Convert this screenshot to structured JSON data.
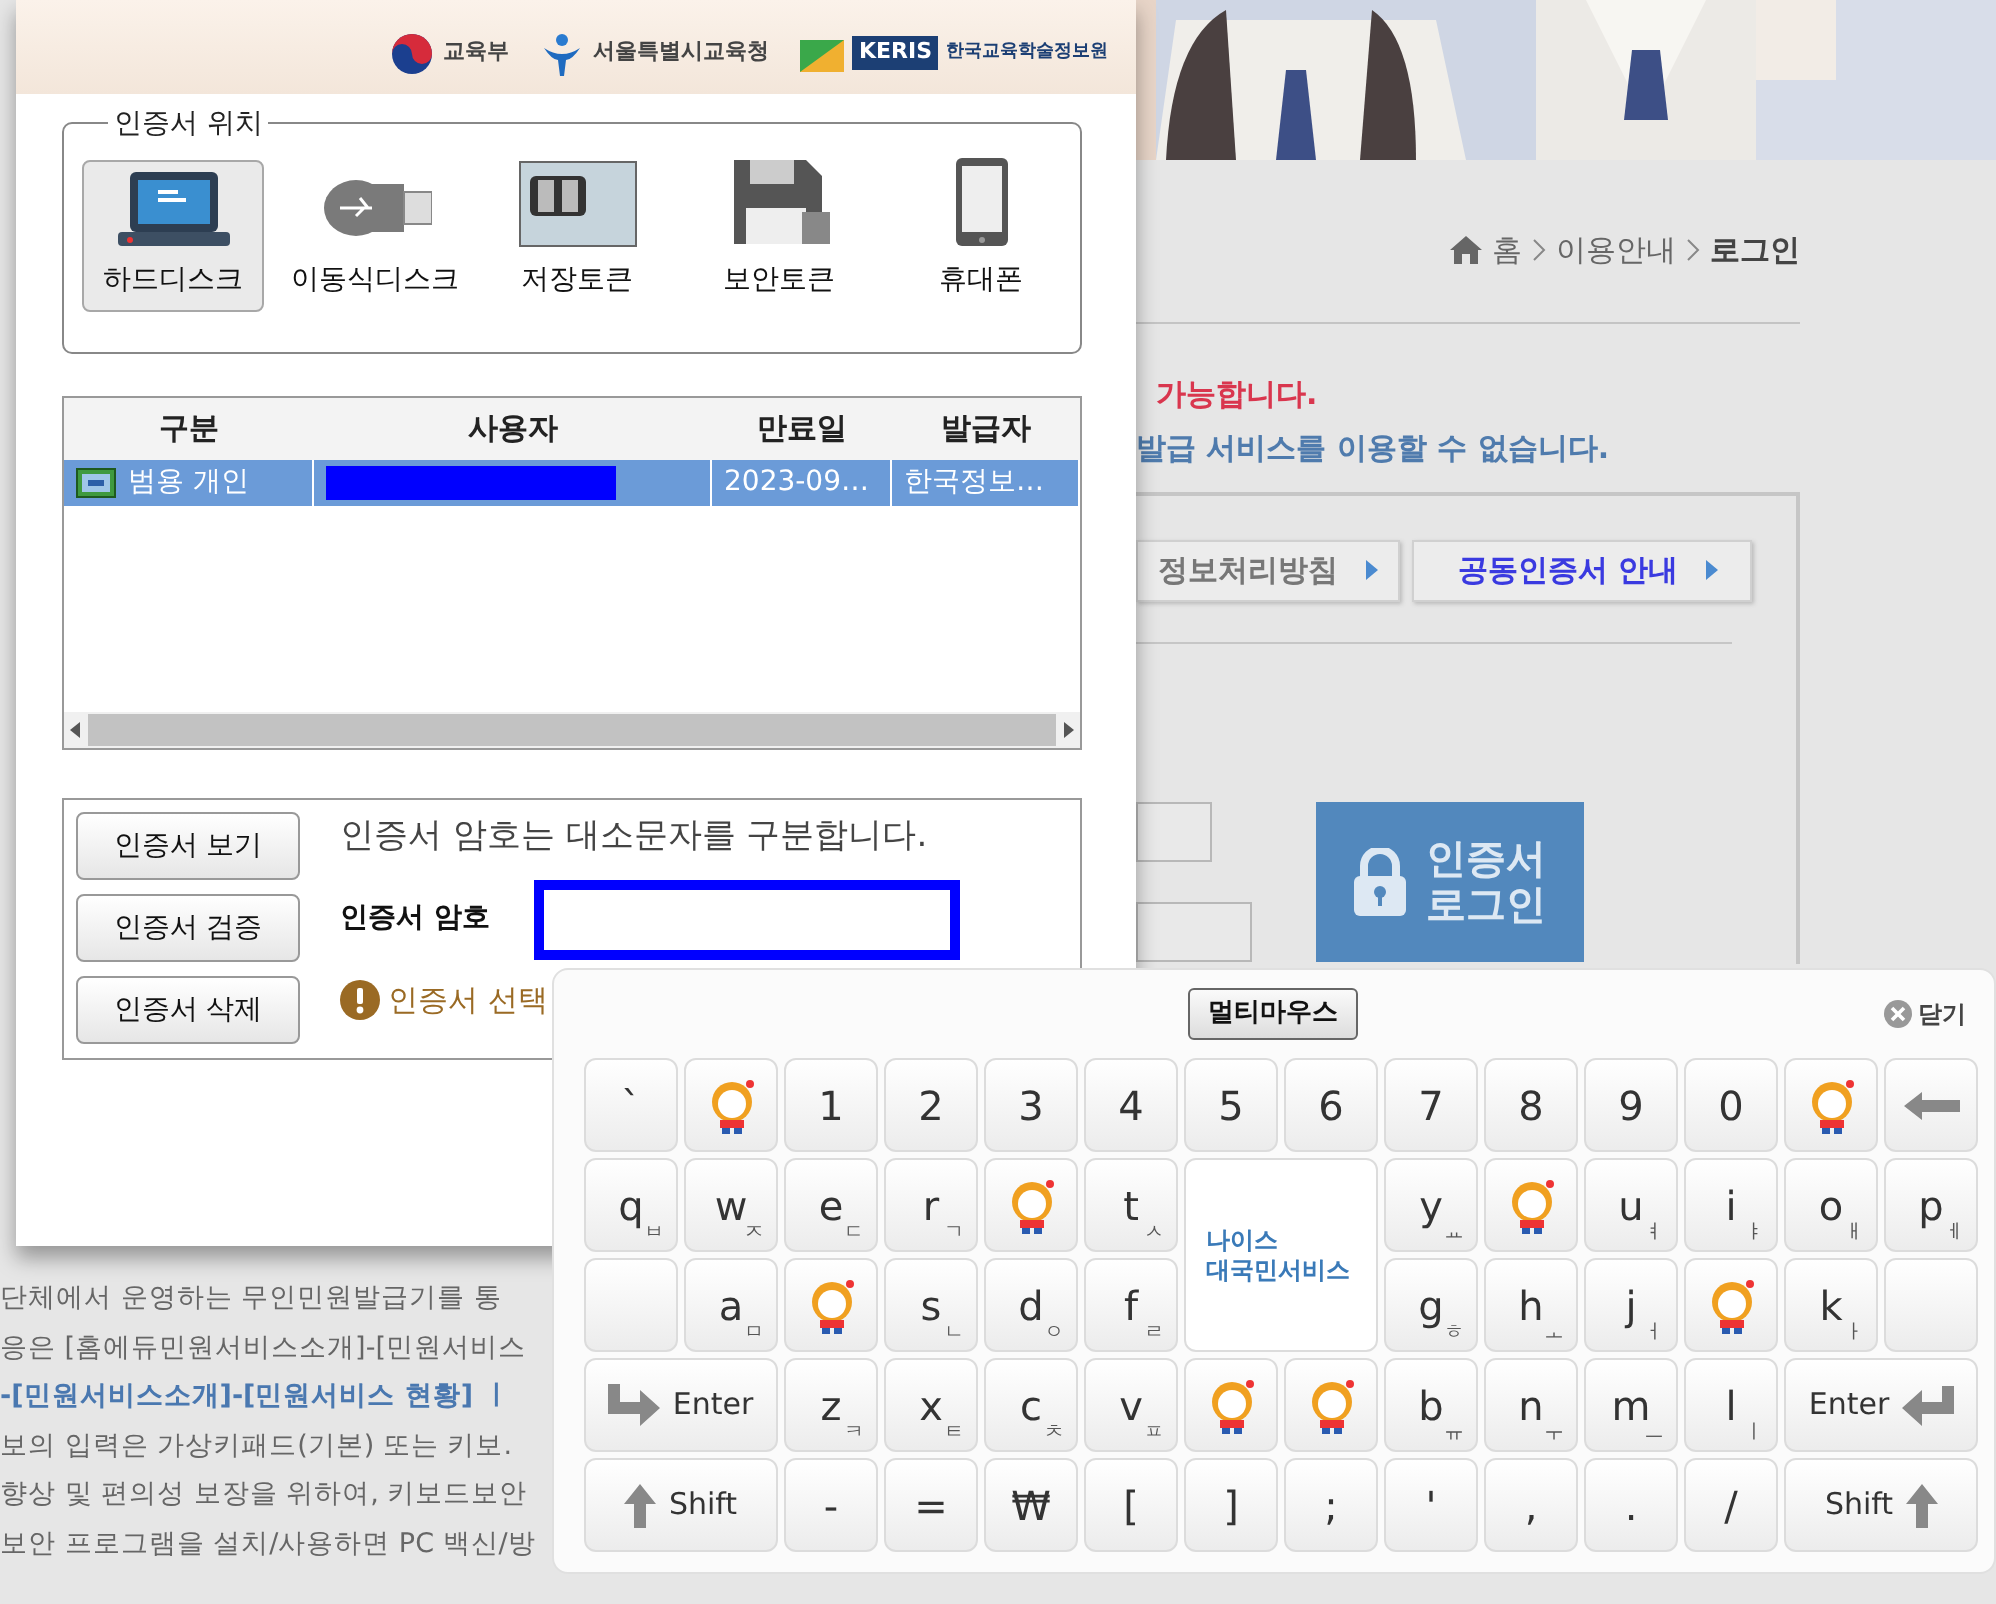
{
  "background_page": {
    "breadcrumb": [
      "홈",
      "이용안내",
      "로그인"
    ],
    "notices": [
      {
        "kind": "alert",
        "text": "가능합니다."
      },
      {
        "kind": "info",
        "text": "발급 서비스를 이용할 수 없습니다."
      }
    ],
    "links": [
      {
        "kind": "plain",
        "label": "정보처리방침"
      },
      {
        "kind": "highlight",
        "label": "공동인증서 안내"
      }
    ],
    "login_button": [
      "인증서",
      "로그인"
    ],
    "body_lines": [
      {
        "kind": "plain",
        "text": "단체에서 운영하는 무인민원발급기를 통"
      },
      {
        "kind": "plain",
        "text": "응은 [홈에듀민원서비스소개]-[민원서비스"
      },
      {
        "kind": "link",
        "text": "-[민원서비스소개]-[민원서비스 현황] ㅣ"
      },
      {
        "kind": "plain",
        "text": "보의 입력은 가상키패드(기본) 또는 키보."
      },
      {
        "kind": "plain",
        "text": "향상 및 편의성 보장을 위하여, 키보드보안"
      },
      {
        "kind": "plain",
        "text": "보안 프로그램을 설치/사용하면 PC 백신/방"
      }
    ]
  },
  "certificate_dialog": {
    "header_logos": [
      {
        "kind": "ministry",
        "label": "교육부"
      },
      {
        "kind": "office",
        "label": "서울특별시교육청"
      },
      {
        "kind": "keris",
        "badge": "KERIS",
        "label": "한국교육학술정보원"
      }
    ],
    "location": {
      "legend": "인증서 위치",
      "options": [
        {
          "kind": "harddisk",
          "label": "하드디스크",
          "selected": true
        },
        {
          "kind": "usb",
          "label": "이동식디스크",
          "selected": false
        },
        {
          "kind": "storage",
          "label": "저장토큰",
          "selected": false
        },
        {
          "kind": "security",
          "label": "보안토큰",
          "selected": false
        },
        {
          "kind": "phone",
          "label": "휴대폰",
          "selected": false
        }
      ]
    },
    "table": {
      "columns": [
        "구분",
        "사용자",
        "만료일",
        "발급자"
      ],
      "rows": [
        {
          "type": "범용 개인",
          "expiry": "2023-09…",
          "issuer": "한국정보…",
          "selected": true
        }
      ]
    },
    "actions": [
      "인증서 보기",
      "인증서 검증",
      "인증서 삭제"
    ],
    "hint": "인증서 암호는 대소문자를 구분합니다.",
    "password_label": "인증서 암호",
    "warning": "인증서 선택"
  },
  "keyboard": {
    "mode_button": "멀티마우스",
    "close": "닫기",
    "rows": [
      [
        {
          "kind": "char",
          "label": "`"
        },
        {
          "kind": "mascot"
        },
        {
          "kind": "char",
          "label": "1"
        },
        {
          "kind": "char",
          "label": "2"
        },
        {
          "kind": "char",
          "label": "3"
        },
        {
          "kind": "char",
          "label": "4"
        },
        {
          "kind": "char",
          "label": "5"
        },
        {
          "kind": "char",
          "label": "6"
        },
        {
          "kind": "char",
          "label": "7"
        },
        {
          "kind": "char",
          "label": "8"
        },
        {
          "kind": "char",
          "label": "9"
        },
        {
          "kind": "char",
          "label": "0"
        },
        {
          "kind": "mascot"
        },
        {
          "kind": "backspace"
        }
      ],
      [
        {
          "kind": "char",
          "label": "q",
          "sub": "ㅂ"
        },
        {
          "kind": "char",
          "label": "w",
          "sub": "ㅈ"
        },
        {
          "kind": "char",
          "label": "e",
          "sub": "ㄷ"
        },
        {
          "kind": "char",
          "label": "r",
          "sub": "ㄱ"
        },
        {
          "kind": "mascot"
        },
        {
          "kind": "char",
          "label": "t",
          "sub": "ㅅ"
        },
        {
          "kind": "logo",
          "lines": [
            "나이스",
            "대국민서비스"
          ],
          "colspan": 2,
          "rowspan": 2
        },
        {
          "kind": "char",
          "label": "y",
          "sub": "ㅛ"
        },
        {
          "kind": "mascot"
        },
        {
          "kind": "char",
          "label": "u",
          "sub": "ㅕ"
        },
        {
          "kind": "char",
          "label": "i",
          "sub": "ㅑ"
        },
        {
          "kind": "char",
          "label": "o",
          "sub": "ㅐ"
        },
        {
          "kind": "char",
          "label": "p",
          "sub": "ㅔ"
        }
      ],
      [
        {
          "kind": "blank"
        },
        {
          "kind": "char",
          "label": "a",
          "sub": "ㅁ"
        },
        {
          "kind": "mascot"
        },
        {
          "kind": "char",
          "label": "s",
          "sub": "ㄴ"
        },
        {
          "kind": "char",
          "label": "d",
          "sub": "ㅇ"
        },
        {
          "kind": "char",
          "label": "f",
          "sub": "ㄹ"
        },
        {
          "kind": "char",
          "label": "g",
          "sub": "ㅎ"
        },
        {
          "kind": "char",
          "label": "h",
          "sub": "ㅗ"
        },
        {
          "kind": "char",
          "label": "j",
          "sub": "ㅓ"
        },
        {
          "kind": "mascot"
        },
        {
          "kind": "char",
          "label": "k",
          "sub": "ㅏ"
        },
        {
          "kind": "blank"
        }
      ],
      [
        {
          "kind": "enter",
          "label": "Enter",
          "colspan": 2
        },
        {
          "kind": "char",
          "label": "z",
          "sub": "ㅋ"
        },
        {
          "kind": "char",
          "label": "x",
          "sub": "ㅌ"
        },
        {
          "kind": "char",
          "label": "c",
          "sub": "ㅊ"
        },
        {
          "kind": "char",
          "label": "v",
          "sub": "ㅍ"
        },
        {
          "kind": "mascot"
        },
        {
          "kind": "mascot"
        },
        {
          "kind": "char",
          "label": "b",
          "sub": "ㅠ"
        },
        {
          "kind": "char",
          "label": "n",
          "sub": "ㅜ"
        },
        {
          "kind": "char",
          "label": "m",
          "sub": "ㅡ"
        },
        {
          "kind": "char",
          "label": "l",
          "sub": "ㅣ"
        },
        {
          "kind": "enter",
          "label": "Enter",
          "colspan": 2
        }
      ],
      [
        {
          "kind": "shift",
          "label": "Shift",
          "colspan": 2
        },
        {
          "kind": "char",
          "label": "-"
        },
        {
          "kind": "char",
          "label": "="
        },
        {
          "kind": "char",
          "label": "₩"
        },
        {
          "kind": "char",
          "label": "["
        },
        {
          "kind": "char",
          "label": "]"
        },
        {
          "kind": "char",
          "label": ";"
        },
        {
          "kind": "char",
          "label": "'"
        },
        {
          "kind": "char",
          "label": ","
        },
        {
          "kind": "char",
          "label": "."
        },
        {
          "kind": "char",
          "label": "/"
        },
        {
          "kind": "shift",
          "label": "Shift",
          "colspan": 2
        }
      ]
    ]
  }
}
